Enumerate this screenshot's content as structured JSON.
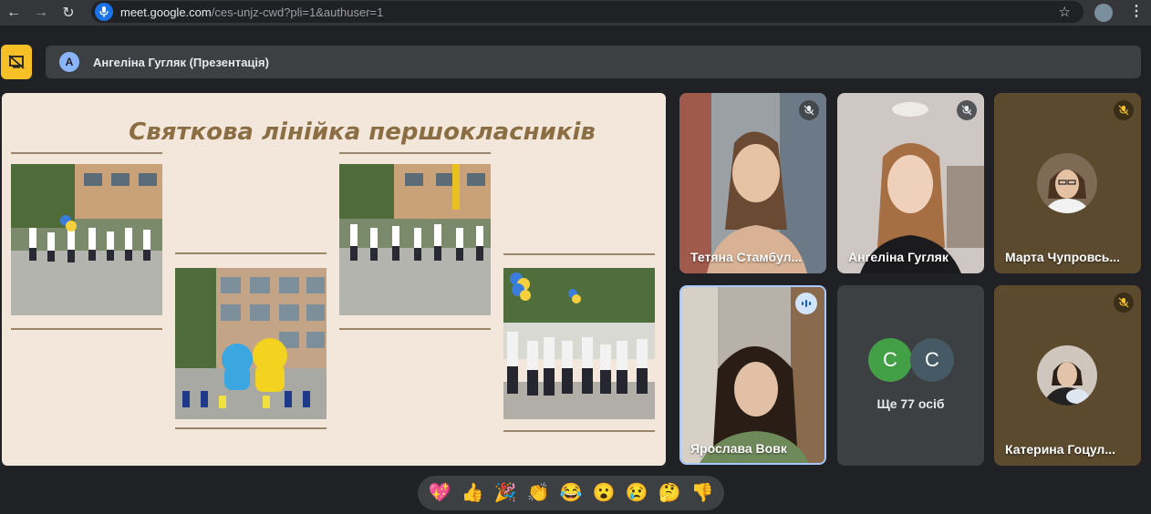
{
  "browser": {
    "url_host": "meet.google.com",
    "url_path": "/ces-unjz-cwd?pli=1&authuser=1"
  },
  "presenter": {
    "avatar_letter": "A",
    "label": "Ангеліна Гугляк (Презентація)"
  },
  "slide": {
    "title": "Святкова лінійка першокласників"
  },
  "participants": [
    {
      "name": "Тетяна Стамбул..."
    },
    {
      "name": "Ангеліна Гугляк"
    },
    {
      "name": "Марта Чупровсь..."
    },
    {
      "name": "Ярослава Вовк"
    },
    {
      "name": "Катерина Гоцул..."
    }
  ],
  "more": {
    "letters": [
      "С",
      "С"
    ],
    "label": "Ще 77 осіб",
    "colors": [
      "#43a047",
      "#455a64"
    ]
  },
  "reactions": [
    {
      "icon": "sparkling-heart",
      "glyph": "💖"
    },
    {
      "icon": "thumbs-up",
      "glyph": "👍"
    },
    {
      "icon": "party-popper",
      "glyph": "🎉"
    },
    {
      "icon": "clapping-hands",
      "glyph": "👏"
    },
    {
      "icon": "tears-of-joy",
      "glyph": "😂"
    },
    {
      "icon": "surprised-face",
      "glyph": "😮"
    },
    {
      "icon": "crying-face",
      "glyph": "😢"
    },
    {
      "icon": "thinking-face",
      "glyph": "🤔"
    },
    {
      "icon": "thumbs-down",
      "glyph": "👎"
    }
  ],
  "colors": {
    "accent_yellow": "#f6c026",
    "speaking_border": "#a8c7fa"
  }
}
